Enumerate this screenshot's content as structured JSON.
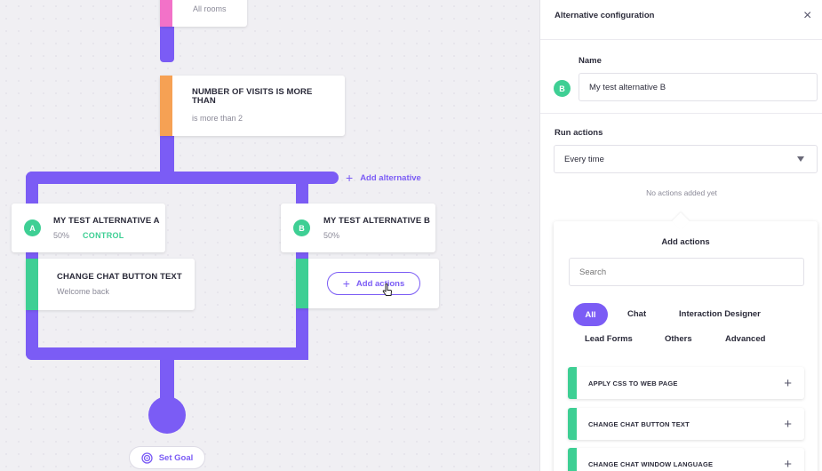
{
  "flow": {
    "top_card_sub": "All rooms",
    "visits_card": {
      "title": "NUMBER OF VISITS IS MORE THAN",
      "sub": "is more than 2"
    },
    "add_alternative_label": "Add alternative",
    "alt_a": {
      "badge": "A",
      "title": "MY TEST ALTERNATIVE A",
      "percent": "50%",
      "tag": "CONTROL"
    },
    "alt_b": {
      "badge": "B",
      "title": "MY TEST ALTERNATIVE B",
      "percent": "50%"
    },
    "action_a": {
      "title": "CHANGE CHAT BUTTON TEXT",
      "sub": "Welcome back"
    },
    "add_actions_label": "Add actions",
    "set_goal_label": "Set Goal"
  },
  "panel": {
    "title": "Alternative configuration",
    "name_label": "Name",
    "name_badge": "B",
    "name_value": "My test alternative B",
    "run_actions_label": "Run actions",
    "run_actions_value": "Every time",
    "no_actions": "No actions added yet",
    "add_actions_title": "Add actions",
    "search_placeholder": "Search",
    "filters": [
      "All",
      "Chat",
      "Interaction Designer",
      "Lead Forms",
      "Others",
      "Advanced"
    ],
    "actions": [
      "APPLY CSS TO WEB PAGE",
      "CHANGE CHAT BUTTON TEXT",
      "CHANGE CHAT WINDOW LANGUAGE"
    ]
  },
  "colors": {
    "accent": "#7b5cf5",
    "green": "#3ecf94",
    "orange": "#f6a154",
    "pink": "#f272c8"
  }
}
